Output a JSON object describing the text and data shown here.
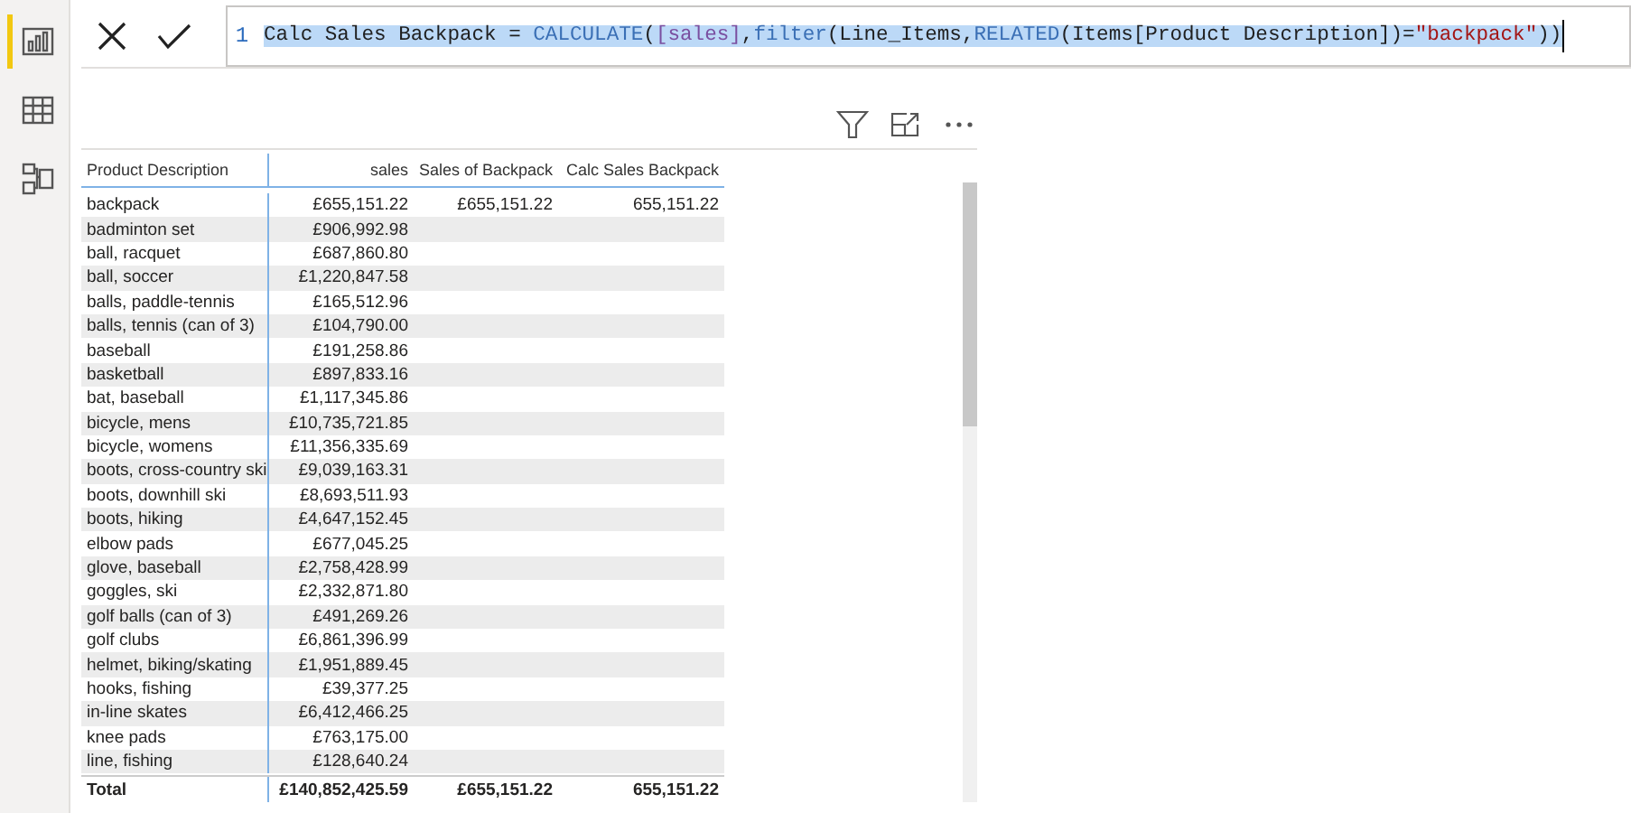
{
  "sidebar": {
    "items": [
      {
        "kind": "report",
        "selected": true
      },
      {
        "kind": "data",
        "selected": false
      },
      {
        "kind": "model",
        "selected": false
      }
    ]
  },
  "formula_bar": {
    "line_number": "1",
    "tokens": [
      {
        "text": "Calc Sales Backpack = ",
        "kind": "plain"
      },
      {
        "text": "CALCULATE",
        "kind": "function"
      },
      {
        "text": "(",
        "kind": "plain"
      },
      {
        "text": "[sales]",
        "kind": "measure"
      },
      {
        "text": ",",
        "kind": "plain"
      },
      {
        "text": "filter",
        "kind": "function"
      },
      {
        "text": "(Line_Items,",
        "kind": "plain"
      },
      {
        "text": "RELATED",
        "kind": "function"
      },
      {
        "text": "(Items[Product Description])=",
        "kind": "plain"
      },
      {
        "text": "\"backpack\"",
        "kind": "string"
      },
      {
        "text": "))",
        "kind": "plain"
      }
    ],
    "selected": true
  },
  "table": {
    "columns": [
      "Product Description",
      "sales",
      "Sales of Backpack",
      "Calc Sales Backpack"
    ],
    "rows": [
      [
        "backpack",
        "£655,151.22",
        "£655,151.22",
        "655,151.22"
      ],
      [
        "badminton set",
        "£906,992.98",
        "",
        ""
      ],
      [
        "ball, racquet",
        "£687,860.80",
        "",
        ""
      ],
      [
        "ball, soccer",
        "£1,220,847.58",
        "",
        ""
      ],
      [
        "balls, paddle-tennis",
        "£165,512.96",
        "",
        ""
      ],
      [
        "balls, tennis (can of 3)",
        "£104,790.00",
        "",
        ""
      ],
      [
        "baseball",
        "£191,258.86",
        "",
        ""
      ],
      [
        "basketball",
        "£897,833.16",
        "",
        ""
      ],
      [
        "bat, baseball",
        "£1,117,345.86",
        "",
        ""
      ],
      [
        "bicycle, mens",
        "£10,735,721.85",
        "",
        ""
      ],
      [
        "bicycle, womens",
        "£11,356,335.69",
        "",
        ""
      ],
      [
        "boots, cross-country ski",
        "£9,039,163.31",
        "",
        ""
      ],
      [
        "boots, downhill ski",
        "£8,693,511.93",
        "",
        ""
      ],
      [
        "boots, hiking",
        "£4,647,152.45",
        "",
        ""
      ],
      [
        "elbow pads",
        "£677,045.25",
        "",
        ""
      ],
      [
        "glove, baseball",
        "£2,758,428.99",
        "",
        ""
      ],
      [
        "goggles, ski",
        "£2,332,871.80",
        "",
        ""
      ],
      [
        "golf balls (can of 3)",
        "£491,269.26",
        "",
        ""
      ],
      [
        "golf clubs",
        "£6,861,396.99",
        "",
        ""
      ],
      [
        "helmet, biking/skating",
        "£1,951,889.45",
        "",
        ""
      ],
      [
        "hooks, fishing",
        "£39,377.25",
        "",
        ""
      ],
      [
        "in-line skates",
        "£6,412,466.25",
        "",
        ""
      ],
      [
        "knee pads",
        "£763,175.00",
        "",
        ""
      ],
      [
        "line, fishing",
        "£128,640.24",
        "",
        ""
      ]
    ],
    "total": [
      "Total",
      "£140,852,425.59",
      "£655,151.22",
      "655,151.22"
    ]
  }
}
